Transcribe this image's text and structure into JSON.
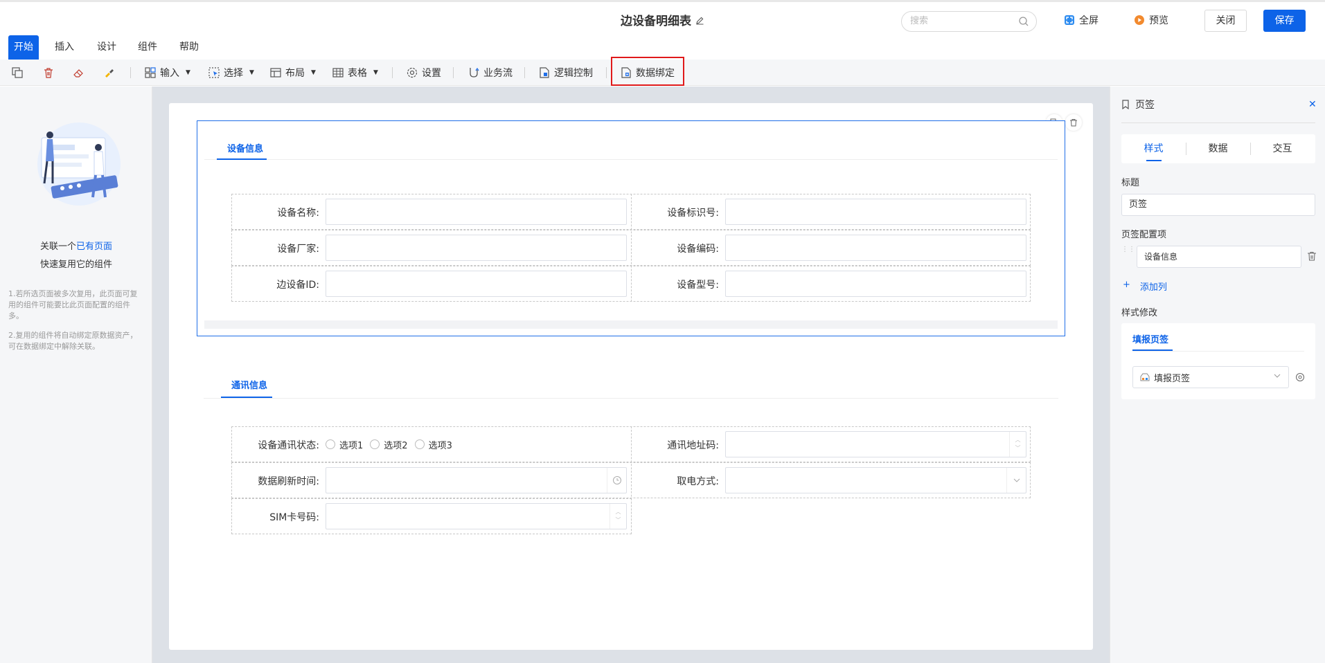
{
  "header": {
    "title": "边设备明细表",
    "search_placeholder": "搜索",
    "fullscreen_label": "全屏",
    "preview_label": "预览",
    "close_label": "关闭",
    "save_label": "保存"
  },
  "menu": {
    "items": [
      "开始",
      "插入",
      "设计",
      "组件",
      "帮助"
    ]
  },
  "toolbar": {
    "input_label": "输入",
    "select_label": "选择",
    "layout_label": "布局",
    "table_label": "表格",
    "settings_label": "设置",
    "workflow_label": "业务流",
    "logic_label": "逻辑控制",
    "databind_label": "数据绑定"
  },
  "left_panel": {
    "line1_prefix": "关联一个",
    "line1_link": "已有页面",
    "line2": "快速复用它的组件",
    "note1": "1.若所选页面被多次复用，此页面可复用的组件可能要比此页面配置的组件多。",
    "note2": "2.复用的组件将自动绑定原数据资产，可在数据绑定中解除关联。"
  },
  "section1": {
    "tab_label": "设备信息",
    "fields": {
      "device_name": "设备名称:",
      "device_id_code": "设备标识号:",
      "manufacturer": "设备厂家:",
      "device_code": "设备编码:",
      "edge_device_id": "边设备ID:",
      "device_model": "设备型号:"
    }
  },
  "section2": {
    "tab_label": "通讯信息",
    "fields": {
      "comm_status": "设备通讯状态:",
      "comm_address": "通讯地址码:",
      "refresh_time": "数据刷新时间:",
      "power_mode": "取电方式:",
      "sim_number": "SIM卡号码:"
    },
    "radio_options": [
      "选项1",
      "选项2",
      "选项3"
    ]
  },
  "right_panel": {
    "title": "页签",
    "tabs": [
      "样式",
      "数据",
      "交互"
    ],
    "title_label": "标题",
    "title_value": "页签",
    "config_label": "页签配置项",
    "config_item": "设备信息",
    "add_column": "添加列",
    "style_modify_label": "样式修改",
    "style_tab": "填报页签",
    "style_select_value": "填报页签"
  },
  "colors": {
    "primary": "#0d63e8",
    "highlight": "#e0191a"
  }
}
